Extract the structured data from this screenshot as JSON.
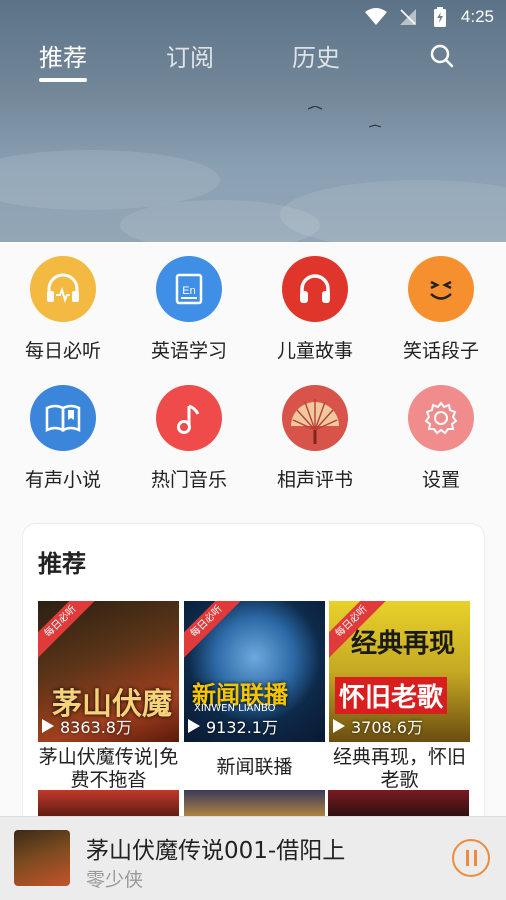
{
  "status_bar": {
    "time": "4:25",
    "icons": [
      "wifi-icon",
      "signal-off-icon",
      "battery-charging-icon"
    ]
  },
  "tabs": [
    {
      "label": "推荐",
      "active": true
    },
    {
      "label": "订阅",
      "active": false
    },
    {
      "label": "历史",
      "active": false
    }
  ],
  "search_icon": "search-icon",
  "categories": [
    {
      "label": "每日必听",
      "icon": "headphone-pulse-icon",
      "color": "#f4b940"
    },
    {
      "label": "英语学习",
      "icon": "english-book-icon",
      "color": "#3f8fe6"
    },
    {
      "label": "儿童故事",
      "icon": "headphones-icon",
      "color": "#e0352b"
    },
    {
      "label": "笑话段子",
      "icon": "smile-face-icon",
      "color": "#f6902e"
    },
    {
      "label": "有声小说",
      "icon": "open-book-icon",
      "color": "#3b86db"
    },
    {
      "label": "热门音乐",
      "icon": "music-note-icon",
      "color": "#ef4b4b"
    },
    {
      "label": "相声评书",
      "icon": "folding-fan-icon",
      "color": "#d8534a"
    },
    {
      "label": "设置",
      "icon": "gear-icon",
      "color": "#f08c8c"
    }
  ],
  "recommend": {
    "title": "推荐",
    "albums": [
      {
        "name": "茅山伏魔传说|免费不拖沓",
        "plays": "8363.8万",
        "ribbon": "每日必听",
        "cover_text": "茅山伏魔"
      },
      {
        "name": "新闻联播",
        "plays": "9132.1万",
        "ribbon": "每日必听",
        "cover_text": "新闻联播",
        "cover_sub": "XINWEN LIANBO"
      },
      {
        "name": "经典再现，怀旧老歌",
        "plays": "3708.6万",
        "ribbon": "每日必听",
        "cover_text": "怀旧老歌",
        "cover_top": "经典再现"
      }
    ]
  },
  "player": {
    "title": "茅山伏魔传说001-借阳上",
    "author": "零少侠",
    "state_icon": "pause-icon"
  },
  "colors": {
    "accent": "#f08a3c",
    "ribbon": "#e03a3a"
  }
}
